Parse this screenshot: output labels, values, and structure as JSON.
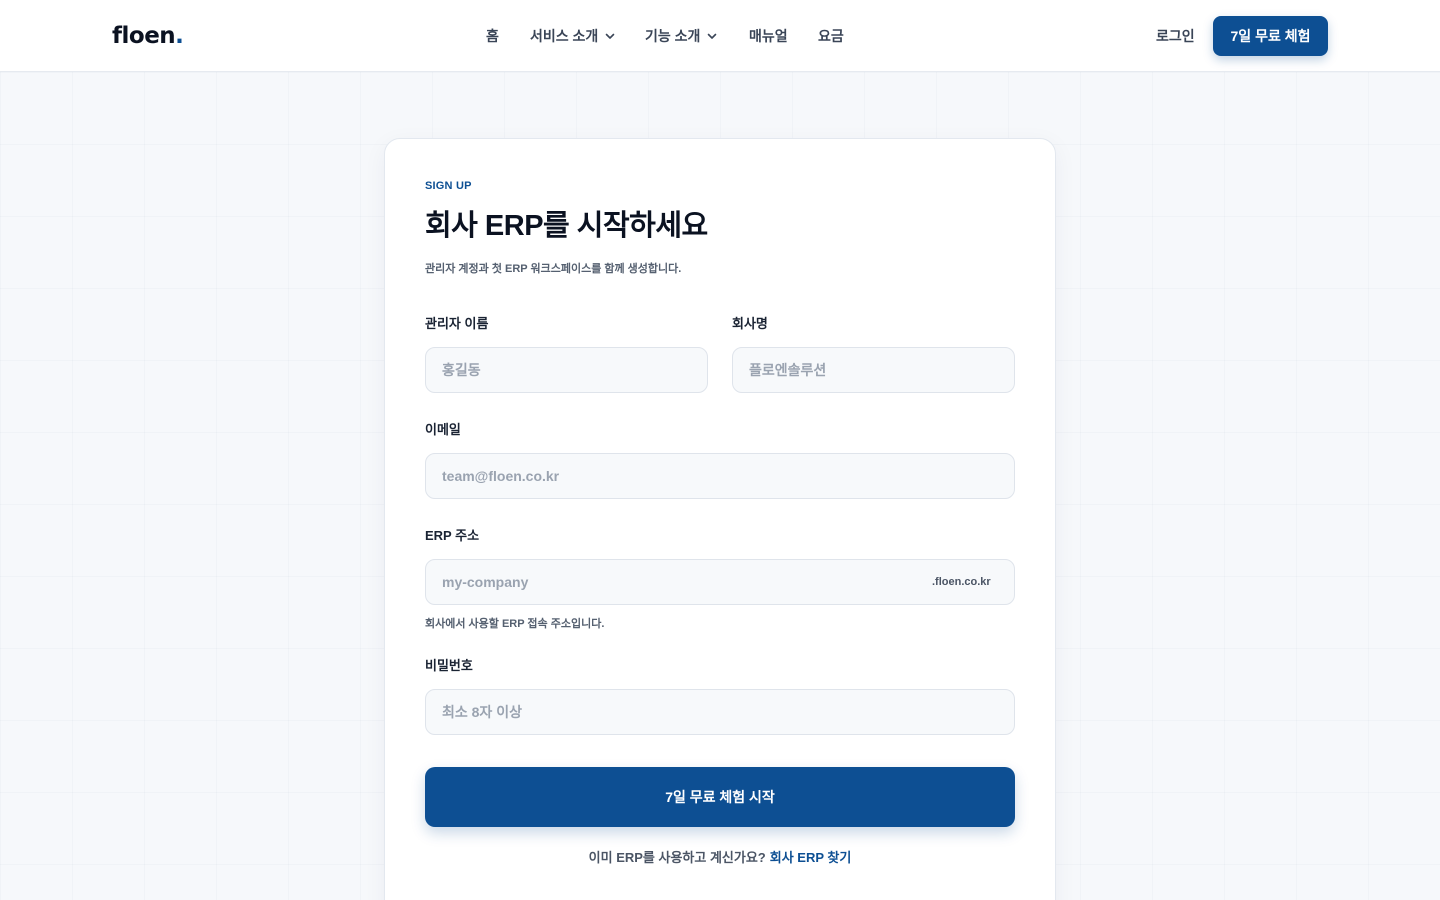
{
  "header": {
    "logo_text": "floen",
    "logo_dot": ".",
    "nav": [
      {
        "label": "홈",
        "has_dropdown": false
      },
      {
        "label": "서비스 소개",
        "has_dropdown": true
      },
      {
        "label": "기능 소개",
        "has_dropdown": true
      },
      {
        "label": "매뉴얼",
        "has_dropdown": false
      },
      {
        "label": "요금",
        "has_dropdown": false
      }
    ],
    "login_label": "로그인",
    "trial_button_label": "7일 무료 체험"
  },
  "signup": {
    "eyebrow": "SIGN UP",
    "title": "회사 ERP를 시작하세요",
    "subtitle": "관리자 계정과 첫 ERP 워크스페이스를 함께 생성합니다.",
    "fields": {
      "admin_name": {
        "label": "관리자 이름",
        "placeholder": "홍길동",
        "value": ""
      },
      "company_name": {
        "label": "회사명",
        "placeholder": "플로엔솔루션",
        "value": ""
      },
      "email": {
        "label": "이메일",
        "placeholder": "team@floen.co.kr",
        "value": ""
      },
      "erp_address": {
        "label": "ERP 주소",
        "placeholder": "my-company",
        "value": "",
        "suffix": ".floen.co.kr",
        "hint": "회사에서 사용할 ERP 접속 주소입니다."
      },
      "password": {
        "label": "비밀번호",
        "placeholder": "최소 8자 이상",
        "value": ""
      }
    },
    "submit_label": "7일 무료 체험 시작",
    "footer_text": "이미 ERP를 사용하고 계신가요?",
    "footer_link": "회사 ERP 찾기"
  },
  "colors": {
    "brand": "#0d4f93",
    "background": "#f6f8fb",
    "text": "#0b1221"
  }
}
